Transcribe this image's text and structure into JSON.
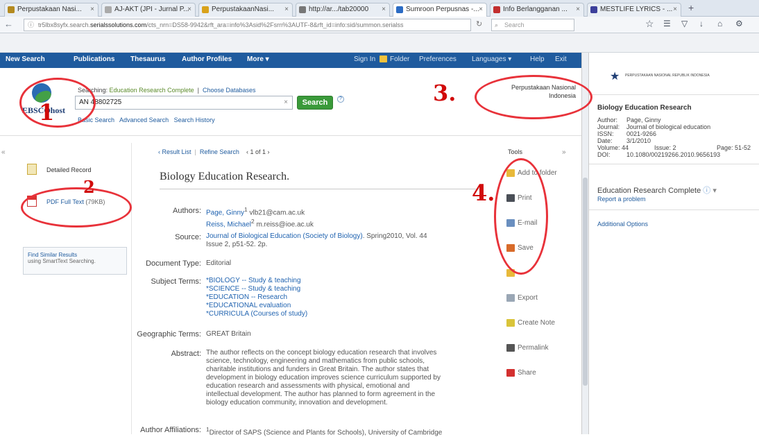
{
  "browser": {
    "tabs": [
      {
        "label": "Perpustakaan Nasi...",
        "color": "#b48a1f"
      },
      {
        "label": "AJ-AKT (JPI - Jurnal P...",
        "color": "#aaaaaa"
      },
      {
        "label": "PerpustakaanNasi...",
        "color": "#d9a21b"
      },
      {
        "label": "http://ar.../tab20000",
        "color": "#777777"
      },
      {
        "label": "Sumroon Perpusnas -...",
        "color": "#2b6cc4",
        "active": true
      },
      {
        "label": "Info Berlangganan ...",
        "color": "#c22f2f"
      },
      {
        "label": "MESTLIFE LYRICS - ...",
        "color": "#3c3f9b"
      }
    ],
    "url_prefix": "tr5lbx8syfx.search.",
    "url_domain": "serialssolutions.com",
    "url_rest": "/cts_nrn=DS58-9942&rft_ara=info%3Asid%2Fsrn%3AUTF-8&rft_id=info:sid/summon.serialss",
    "search_placeholder": "Search"
  },
  "nav": {
    "items": [
      "New Search",
      "Publications",
      "Thesaurus",
      "Author Profiles",
      "More ▾"
    ],
    "right": [
      "Sign In",
      "Folder",
      "Preferences",
      "Languages ▾",
      "Help",
      "Exit"
    ]
  },
  "header": {
    "logo": "EBSCOhost",
    "searching_label": "Searching:",
    "database": "Education Research Complete",
    "choose_db": "Choose Databases",
    "query": "AN 48802725",
    "search_button": "Search",
    "basic_search": "Basic Search",
    "advanced_search": "Advanced Search",
    "search_history": "Search History",
    "institution_line1": "Perpustakaan Nasional",
    "institution_line2": "Indonesia"
  },
  "left": {
    "detailed_record": "Detailed Record",
    "pdf_fulltext": "PDF Full Text",
    "pdf_size": "(79KB)",
    "find_similar": "Find Similar Results",
    "smarttext": "using SmartText Searching."
  },
  "record": {
    "result_list": "‹ Result List",
    "refine_search": "Refine Search",
    "counter": "‹ 1 of 1 ›",
    "title": "Biology Education Research.",
    "authors_label": "Authors:",
    "author1": "Page, Ginny",
    "author1_email": "vlb21@cam.ac.uk",
    "author2": "Reiss, Michael",
    "author2_email": "m.reiss@ioe.ac.uk",
    "source_label": "Source:",
    "source_link": "Journal of Biological Education (Society of Biology)",
    "source_rest": ". Spring2010, Vol. 44",
    "source_line2": "Issue 2, p51-52. 2p.",
    "doctype_label": "Document Type:",
    "doctype": "Editorial",
    "subject_label": "Subject Terms:",
    "subjects": [
      "*BIOLOGY -- Study & teaching",
      "*SCIENCE -- Study & teaching",
      "*EDUCATION -- Research",
      "*EDUCATIONAL evaluation",
      "*CURRICULA (Courses of study)"
    ],
    "geo_label": "Geographic Terms:",
    "geo": "GREAT Britain",
    "abstract_label": "Abstract:",
    "abstract_lines": [
      "The author reflects on the concept biology education research that involves",
      "science, technology, engineering and mathematics from public schools,",
      "charitable institutions and funders in Great Britain. The author states that",
      "development in biology education improves science curriculum supported by",
      "education research and assessments with physical, emotional and",
      "intellectual development. The author has planned to form agreement in the",
      "biology education community, innovation and development."
    ],
    "affil_label": "Author Affiliations:",
    "affil": "Director of SAPS (Science and Plants for Schools), University of Cambridge"
  },
  "tools": {
    "heading": "Tools",
    "items": [
      {
        "label": "Add to folder",
        "color": "#e8b93a"
      },
      {
        "label": "Print",
        "color": "#4a4f57"
      },
      {
        "label": "E-mail",
        "color": "#6a8fbf"
      },
      {
        "label": "Save",
        "color": "#d86b2a"
      },
      {
        "label": "",
        "color": "#e8b93a"
      },
      {
        "label": "Export",
        "color": "#9aa7b5"
      },
      {
        "label": "Create Note",
        "color": "#d9c43a"
      },
      {
        "label": "Permalink",
        "color": "#555555"
      },
      {
        "label": "Share",
        "color": "#d3302f"
      }
    ]
  },
  "right_panel": {
    "library_name": "PERPUSTAKAAN NASIONAL REPUBLIK INDONESIA",
    "citation_title": "Biology Education Research",
    "author_label": "Author:",
    "author": "Page, Ginny",
    "journal_label": "Journal:",
    "journal": "Journal of biological education",
    "issn_label": "ISSN:",
    "issn": "0021-9266",
    "date_label": "Date:",
    "date": "3/1/2010",
    "volume_label": "Volume: 44",
    "issue": "Issue: 2",
    "page": "Page: 51-52",
    "doi_label": "DOI:",
    "doi": "10.1080/00219266.2010.9656193",
    "db": "Education Research Complete",
    "report": "Report a problem",
    "additional": "Additional Options"
  },
  "annotations": [
    "1",
    "2",
    "3.",
    "4."
  ]
}
